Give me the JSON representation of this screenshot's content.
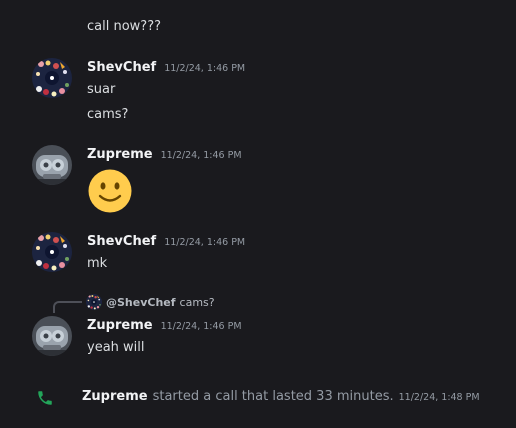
{
  "colors": {
    "background": "#1a1a1e",
    "text": "#dbdee1",
    "username": "#f2f3f5",
    "timestamp": "#949ba4",
    "call_icon": "#23a55a"
  },
  "messages": [
    {
      "type": "continuation",
      "text": "call now???"
    },
    {
      "type": "group",
      "avatar": "shevchef-avatar",
      "username": "ShevChef",
      "timestamp": "11/2/24, 1:46 PM",
      "lines": [
        "suar",
        "cams?"
      ]
    },
    {
      "type": "group",
      "avatar": "zupreme-avatar",
      "username": "Zupreme",
      "timestamp": "11/2/24, 1:46 PM",
      "emoji": "slightly-smiling-face-emoji"
    },
    {
      "type": "group",
      "avatar": "shevchef-avatar",
      "username": "ShevChef",
      "timestamp": "11/2/24, 1:46 PM",
      "lines": [
        "mk"
      ]
    },
    {
      "type": "reply",
      "reply_to": {
        "user": "@ShevChef",
        "text": "cams?"
      },
      "avatar": "zupreme-avatar",
      "username": "Zupreme",
      "timestamp": "11/2/24, 1:46 PM",
      "lines": [
        "yeah will"
      ]
    }
  ],
  "call": {
    "icon": "phone-icon",
    "user": "Zupreme",
    "text": "started a call that lasted 33 minutes.",
    "timestamp": "11/2/24, 1:48 PM"
  }
}
